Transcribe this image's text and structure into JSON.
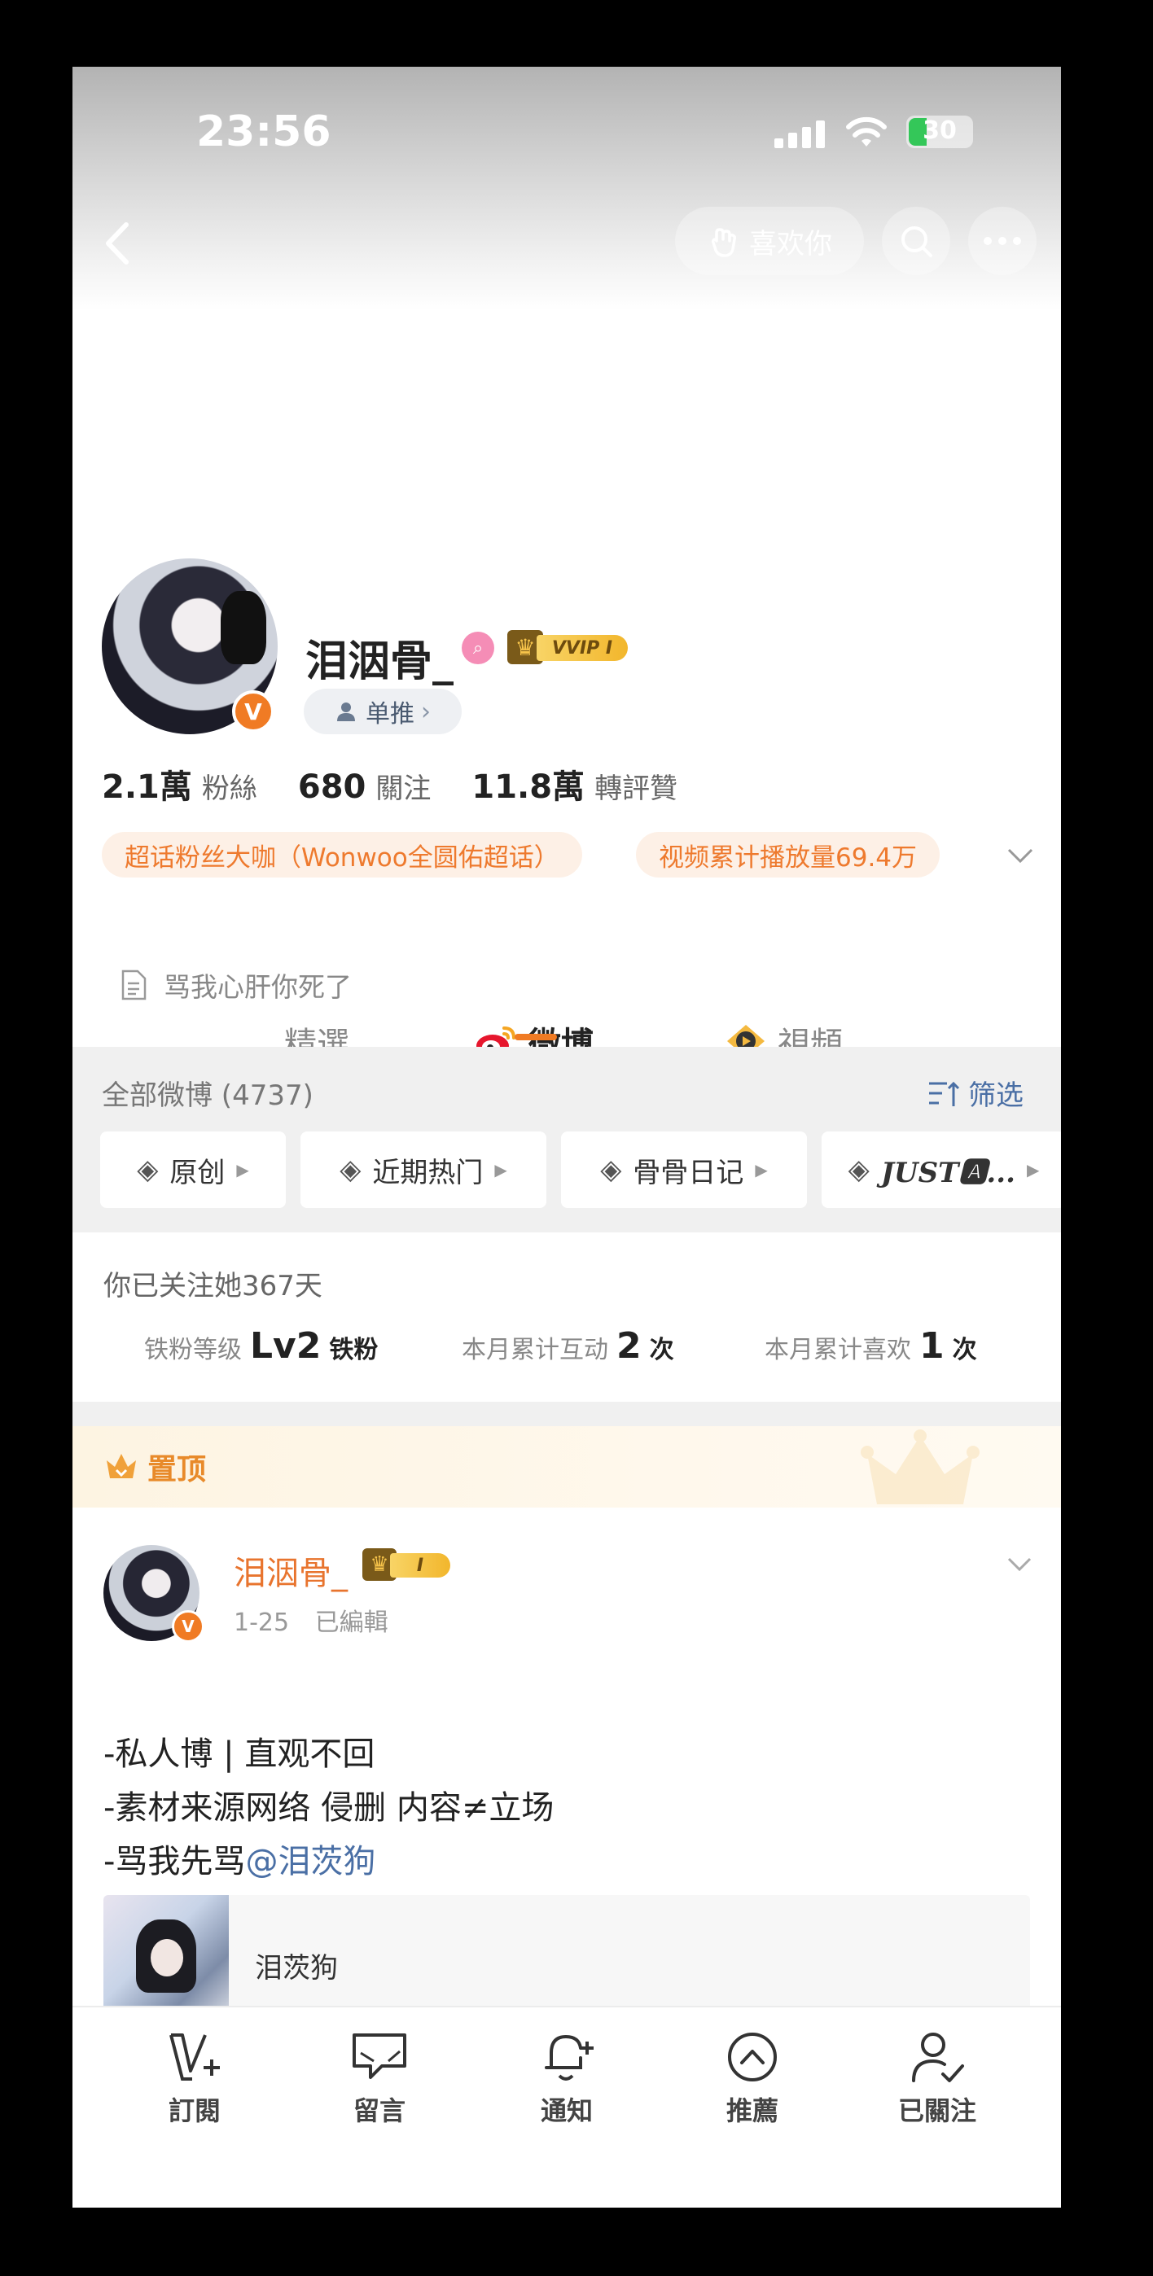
{
  "status_bar": {
    "time": "23:56",
    "battery": "30"
  },
  "header": {
    "like_label": "喜欢你"
  },
  "profile": {
    "username": "泪洇骨_",
    "vip_label": "VVIP I",
    "verified_badge": "V",
    "single_label": "单推",
    "stats": [
      {
        "value": "2.1萬",
        "label": "粉絲"
      },
      {
        "value": "680",
        "label": "關注"
      },
      {
        "value": "11.8萬",
        "label": "轉評贊"
      }
    ],
    "tags": [
      "超话粉丝大咖（Wonwoo全圆佑超话）",
      "视频累计播放量69.4万"
    ],
    "bio": "骂我心肝你死了"
  },
  "tabs": [
    {
      "label": "精選"
    },
    {
      "label": "微博"
    },
    {
      "label": "視頻"
    }
  ],
  "filter": {
    "all_label": "全部微博 (4737)",
    "filter_label": "筛选",
    "chips": [
      "原创",
      "近期热门",
      "骨骨日记",
      "JUST🅰..."
    ]
  },
  "fan_info": {
    "follow_days": "你已关注她367天",
    "level_label": "铁粉等级",
    "level_value": "Lv2",
    "level_suffix": "铁粉",
    "interact_label": "本月累计互动",
    "interact_value": "2",
    "interact_unit": "次",
    "like_label": "本月累计喜欢",
    "like_value": "1",
    "like_unit": "次"
  },
  "pinned": {
    "label": "置顶",
    "post": {
      "author": "泪洇骨_",
      "vip_label": "I",
      "date": "1-25",
      "edited": "已編輯",
      "lines": [
        "-私人博 | 直观不回",
        "-素材来源网络 侵删 内容≠立场",
        "-骂我先骂"
      ],
      "mention": "@泪茨狗",
      "card_title": "泪茨狗"
    }
  },
  "bottom_bar": [
    {
      "label": "訂閱",
      "icon": "subscribe-icon"
    },
    {
      "label": "留言",
      "icon": "message-icon"
    },
    {
      "label": "通知",
      "icon": "bell-add-icon"
    },
    {
      "label": "推薦",
      "icon": "up-arrow-circle-icon"
    },
    {
      "label": "已關注",
      "icon": "user-check-icon"
    }
  ],
  "colors": {
    "accent": "#f07b24",
    "link": "#4a6fa5",
    "tag_bg": "#fdf0e6"
  }
}
